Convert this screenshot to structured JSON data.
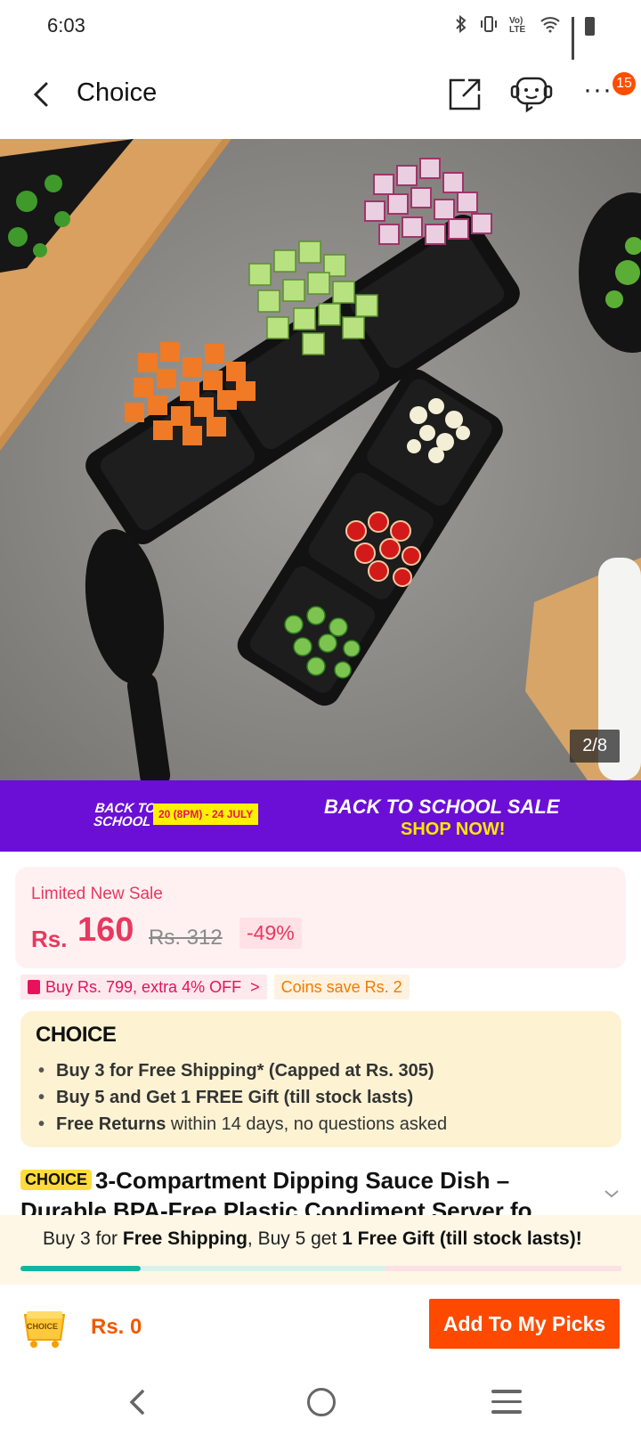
{
  "status_bar": {
    "time": "6:03",
    "network_label": "Vo) LTE"
  },
  "header": {
    "title": "Choice",
    "more_label": "···",
    "cart_count": "15"
  },
  "product_image": {
    "counter": "2/8"
  },
  "promo": {
    "logo_line1": "BACK TO",
    "logo_line2": "SCHOOL",
    "date_range": "20 (8PM) - 24 JULY",
    "title": "BACK TO SCHOOL SALE",
    "cta": "SHOP NOW!"
  },
  "price": {
    "label": "Limited New Sale",
    "currency": "Rs.",
    "current": "160",
    "original": "Rs. 312",
    "discount": "-49%"
  },
  "coupons": {
    "offer": "Buy Rs. 799, extra 4% OFF",
    "offer_arrow": ">",
    "coins": "Coins save Rs. 2"
  },
  "choice": {
    "logo": "CHOICE",
    "line1": "Buy 3 for  Free Shipping* (Capped at Rs. 305)",
    "line2": "Buy 5 and Get 1 FREE Gift (till stock lasts)",
    "line3_bold": "Free Returns",
    "line3_rest": " within 14 days, no questions asked"
  },
  "product": {
    "badge": "CHOICE",
    "title": "3-Compartment Dipping Sauce Dish – Durable BPA-Free Plastic Condiment Server fo..."
  },
  "shipping_bar": {
    "part1": "Buy 3 for ",
    "part2": "Free Shipping",
    "part3": ", Buy 5 get ",
    "part4": "1 Free Gift (till stock lasts)!",
    "progress": 0.2
  },
  "action_bar": {
    "cart_badge": "CHOICE",
    "total": "Rs. 0",
    "add_button": "Add To My Picks"
  },
  "colors": {
    "accent": "#fd4a00",
    "promo_bg": "#6b0fd6",
    "price": "#e8385f",
    "progress": "#13b5a0"
  }
}
